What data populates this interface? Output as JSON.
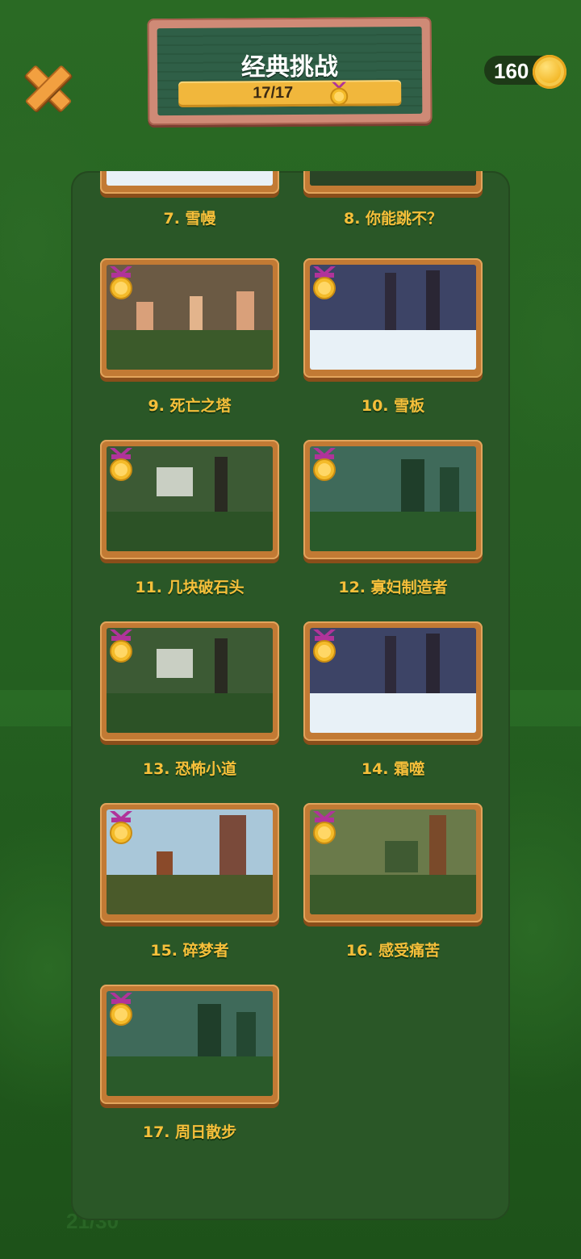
{
  "header": {
    "title": "经典挑战",
    "progress_text": "17/17",
    "progress": 1.0
  },
  "coins": {
    "count": "160"
  },
  "background": {
    "ghost_text": "21/30"
  },
  "levels": [
    {
      "label": "7. 雪幔",
      "theme": "snow",
      "medal": true,
      "partial": true
    },
    {
      "label": "8. 你能跳不？",
      "theme": "forest",
      "medal": true,
      "partial": true
    },
    {
      "label": "9. 死亡之塔",
      "theme": "desert",
      "medal": true
    },
    {
      "label": "10. 雪板",
      "theme": "snow",
      "medal": true
    },
    {
      "label": "11. 几块破石头",
      "theme": "jungle",
      "medal": true
    },
    {
      "label": "12. 寡妇制造者",
      "theme": "pine",
      "medal": true
    },
    {
      "label": "13. 恐怖小道",
      "theme": "jungle",
      "medal": true
    },
    {
      "label": "14. 霜噬",
      "theme": "snow",
      "medal": true
    },
    {
      "label": "15. 碎梦者",
      "theme": "savanna",
      "medal": true
    },
    {
      "label": "16. 感受痛苦",
      "theme": "swamp",
      "medal": true
    },
    {
      "label": "17. 周日散步",
      "theme": "pine",
      "medal": true
    }
  ],
  "colors": {
    "label": "#f6bf3a",
    "frame": "#c27a34",
    "panel": "#2a5727",
    "medal_ribbon": "#b0339a",
    "medal_gold": "#f4bb2a"
  },
  "icons": {
    "close": "close-icon",
    "coin": "coin-icon",
    "medal": "medal-icon"
  }
}
